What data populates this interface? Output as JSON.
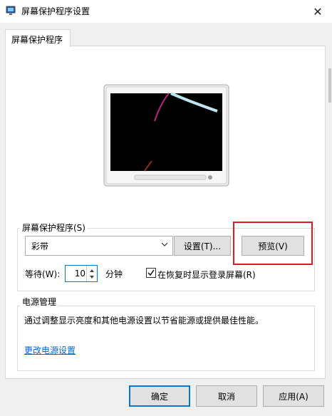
{
  "window": {
    "title": "屏幕保护程序设置",
    "close_glyph": "✕"
  },
  "tabs": [
    {
      "label": "屏幕保护程序"
    }
  ],
  "screensaver": {
    "group_label": "屏幕保护程序(S)",
    "selected": "彩带",
    "settings_label": "设置(T)...",
    "preview_label": "预览(V)",
    "wait_label": "等待(W):",
    "wait_value": "10",
    "wait_unit": "分钟",
    "resume_checked": true,
    "resume_label": "在恢复时显示登录屏幕(R)"
  },
  "power": {
    "group_label": "电源管理",
    "description": "通过调整显示亮度和其他电源设置以节省能源或提供最佳性能。",
    "link_label": "更改电源设置"
  },
  "footer": {
    "ok_label": "确定",
    "cancel_label": "取消",
    "apply_label": "应用(A)"
  },
  "colors": {
    "highlight": "#e01b1b",
    "link": "#0066cc",
    "accent": "#0078d7",
    "ribbon": "#b5267f"
  },
  "icons": [
    "app-icon",
    "close-icon",
    "chevron-down-icon",
    "spin-up-icon",
    "spin-down-icon",
    "check-icon",
    "power-button-icon"
  ]
}
